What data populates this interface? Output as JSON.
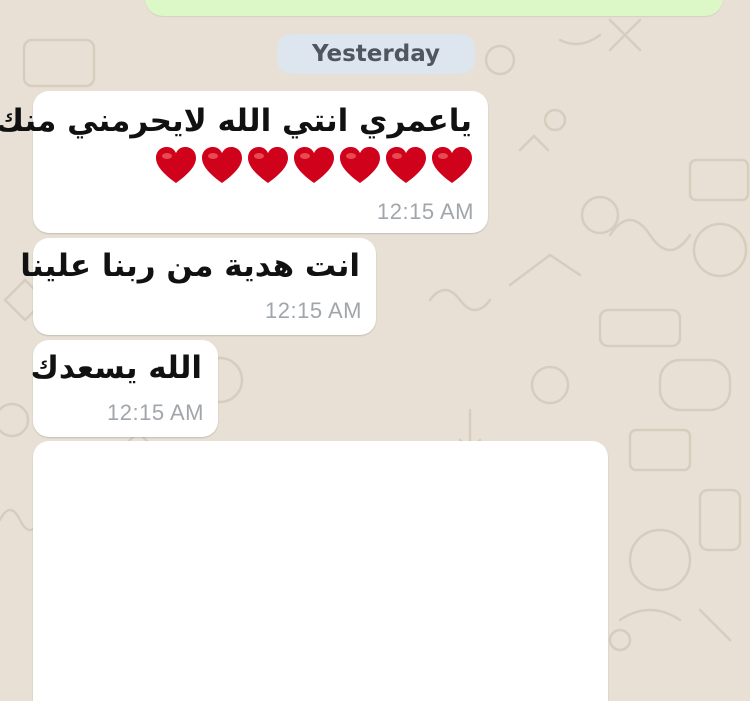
{
  "colors": {
    "wallpaper": "#e8e0d4",
    "outgoing_bubble": "#dcf8c6",
    "incoming_bubble": "#ffffff",
    "date_pill": "#dde5ee",
    "timestamp": "#a1a6ab",
    "heart": "#d0021b"
  },
  "date_separator": "Yesterday",
  "messages": [
    {
      "text": "ياعمري انتي الله لايحرمني منك",
      "emoji": "heart",
      "emoji_count": 7,
      "time": "12:15 AM"
    },
    {
      "text": "انت هدية من ربنا علينا",
      "time": "12:15 AM"
    },
    {
      "text": "الله يسعدك",
      "time": "12:15 AM"
    }
  ]
}
